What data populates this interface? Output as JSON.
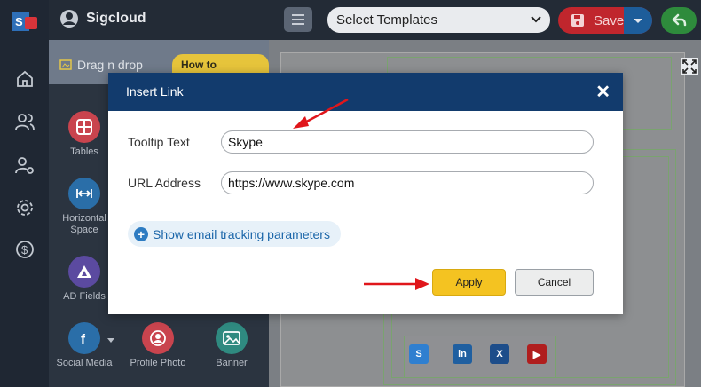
{
  "app": {
    "brand_name": "Sigcloud",
    "template_select": "Select Templates",
    "save_label": "Save"
  },
  "panel": {
    "drag_drop_label": "Drag n drop",
    "how_to_label": "How to design?",
    "tools": [
      {
        "label": "Tables",
        "icon": "table-icon"
      },
      {
        "label": "Horizontal Space",
        "icon": "horizontal-space-icon"
      },
      {
        "label": "AD Fields",
        "icon": "ad-fields-icon"
      },
      {
        "label": "Social Media",
        "icon": "social-media-icon"
      },
      {
        "label": "Profile Photo",
        "icon": "profile-photo-icon"
      },
      {
        "label": "Banner",
        "icon": "banner-icon"
      }
    ]
  },
  "dialog": {
    "title": "Insert Link",
    "tooltip_label": "Tooltip Text",
    "tooltip_value": "Skype",
    "url_label": "URL Address",
    "url_value": "https://www.skype.com",
    "tracking_label": "Show email tracking parameters",
    "apply_label": "Apply",
    "cancel_label": "Cancel"
  },
  "canvas": {
    "social_icons": [
      "skype-icon",
      "linkedin-icon",
      "x-icon",
      "youtube-icon"
    ]
  },
  "colors": {
    "dialog_header": "#123b6d",
    "apply": "#f4c321",
    "save": "#c0262d",
    "annotation_arrow": "#e0161b"
  }
}
